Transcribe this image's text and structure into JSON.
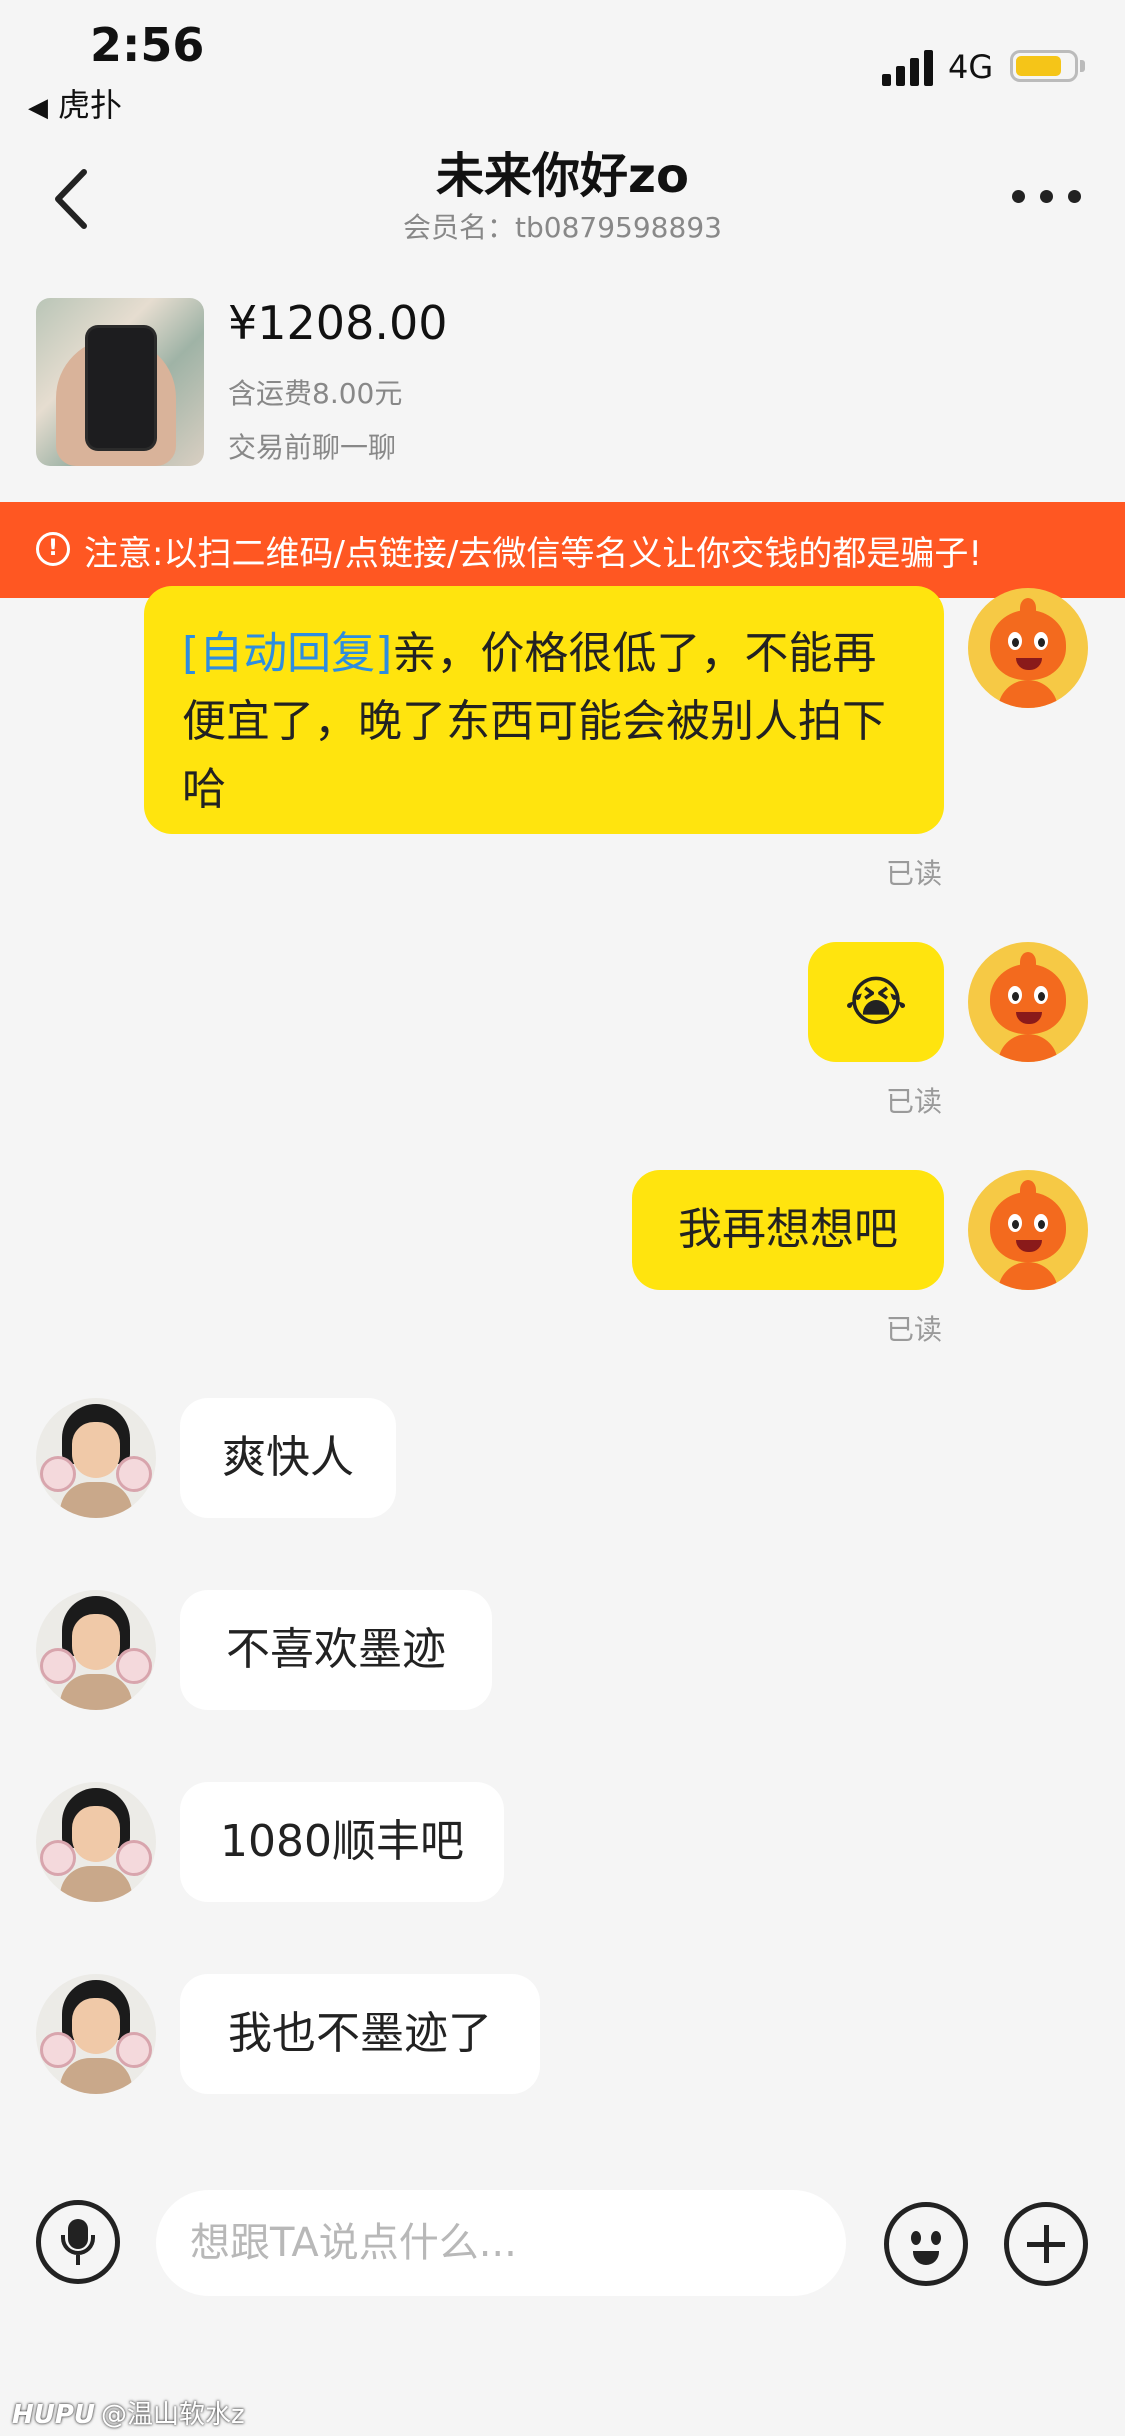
{
  "status_bar": {
    "time": "2:56",
    "back_app": "虎扑",
    "back_arrow": "◀",
    "network": "4G",
    "battery_level": 0.8
  },
  "header": {
    "title": "未来你好zo",
    "member": "会员名：tb0879598893",
    "more_icon": "more-icon"
  },
  "product": {
    "price": "¥1208.00",
    "shipping": "含运费8.00元",
    "subtitle": "交易前聊一聊"
  },
  "warning": {
    "icon": "!",
    "text": "注意:以扫二维码/点链接/去微信等名义让你交钱的都是骗子!"
  },
  "messages": [
    {
      "from": "me",
      "tag": "[自动回复]",
      "text": "亲，价格很低了，不能再便宜了，晚了东西可能会被别人拍下哈",
      "status": "已读"
    },
    {
      "from": "me",
      "text": "😭",
      "status": "已读"
    },
    {
      "from": "me",
      "text": "我再想想吧",
      "status": "已读"
    },
    {
      "from": "them",
      "text": "爽快人"
    },
    {
      "from": "them",
      "text": "不喜欢墨迹"
    },
    {
      "from": "them",
      "text": "1080顺丰吧"
    },
    {
      "from": "them",
      "text": "我也不墨迹了"
    }
  ],
  "input_bar": {
    "placeholder": "想跟TA说点什么..."
  },
  "watermark": {
    "brand": "HUPU",
    "user": "@温山软水z"
  }
}
